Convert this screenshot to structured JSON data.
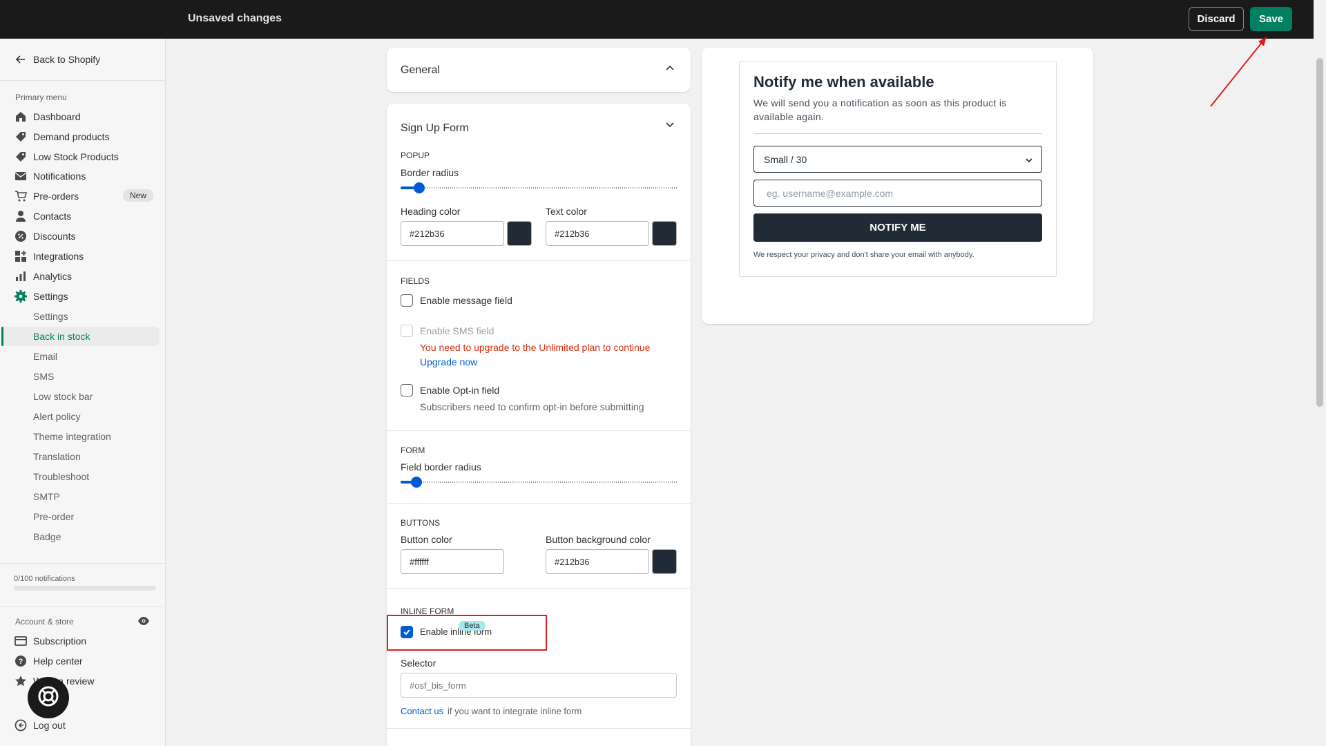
{
  "topbar": {
    "title": "Unsaved changes",
    "discard_label": "Discard",
    "save_label": "Save"
  },
  "sidebar": {
    "back_label": "Back to Shopify",
    "primary_heading": "Primary menu",
    "items": [
      {
        "label": "Dashboard",
        "icon": "home-icon"
      },
      {
        "label": "Demand products",
        "icon": "tag-icon"
      },
      {
        "label": "Low Stock Products",
        "icon": "tag-icon"
      },
      {
        "label": "Notifications",
        "icon": "mail-icon"
      },
      {
        "label": "Pre-orders",
        "icon": "cart-icon",
        "badge": "New"
      },
      {
        "label": "Contacts",
        "icon": "person-icon"
      },
      {
        "label": "Discounts",
        "icon": "discount-icon"
      },
      {
        "label": "Integrations",
        "icon": "apps-icon"
      },
      {
        "label": "Analytics",
        "icon": "bar-chart-icon"
      },
      {
        "label": "Settings",
        "icon": "gear-icon"
      }
    ],
    "settings_sub": [
      "Settings",
      "Back in stock",
      "Email",
      "SMS",
      "Low stock bar",
      "Alert policy",
      "Theme integration",
      "Translation",
      "Troubleshoot",
      "SMTP",
      "Pre-order",
      "Badge"
    ],
    "active_sub": "Back in stock",
    "notifications_usage": "0/100 notifications",
    "notifications_fraction": 0,
    "account_heading": "Account & store",
    "account_items": [
      {
        "label": "Subscription",
        "icon": "card-icon"
      },
      {
        "label": "Help center",
        "icon": "help-icon"
      },
      {
        "label": "Write a review",
        "icon": "star-icon"
      },
      {
        "label": "Log out",
        "icon": "logout-icon"
      }
    ]
  },
  "general": {
    "title": "General"
  },
  "signup": {
    "title": "Sign Up Form",
    "popup_heading": "POPUP",
    "border_radius_label": "Border radius",
    "border_radius_fraction": 0.05,
    "heading_color_label": "Heading color",
    "heading_color_value": "#212b36",
    "text_color_label": "Text color",
    "text_color_value": "#212b36",
    "fields_heading": "FIELDS",
    "message_field_label": "Enable message field",
    "sms_field_label": "Enable SMS field",
    "sms_upgrade_error": "You need to upgrade to the Unlimited plan to continue",
    "upgrade_link": "Upgrade now",
    "optin_label": "Enable Opt-in field",
    "optin_help": "Subscribers need to confirm opt-in before submitting",
    "form_heading": "FORM",
    "field_border_radius_label": "Field border radius",
    "field_border_radius_fraction": 0.04,
    "buttons_heading": "BUTTONS",
    "button_color_label": "Button color",
    "button_color_value": "#ffffff",
    "button_bg_label": "Button background color",
    "button_bg_value": "#212b36",
    "inline_heading": "INLINE FORM",
    "beta_badge": "Beta",
    "inline_label": "Enable inline form",
    "inline_checked": true,
    "selector_label": "Selector",
    "selector_placeholder": "#osf_bis_form",
    "contact_link": "Contact us",
    "contact_help": " if you want to integrate inline form"
  },
  "preview": {
    "title": "Notify me when available",
    "description": "We will send you a notification as soon as this product is available again.",
    "variant_selected": "Small / 30",
    "email_placeholder": "eg. username@example.com",
    "button_label": "NOTIFY ME",
    "privacy": "We respect your privacy and don't share your email with anybody."
  },
  "colors": {
    "accent": "#008060",
    "primary_blue": "#005bd3",
    "dark": "#212b36",
    "error": "#d72c0d",
    "annotation": "#e01c1c"
  }
}
